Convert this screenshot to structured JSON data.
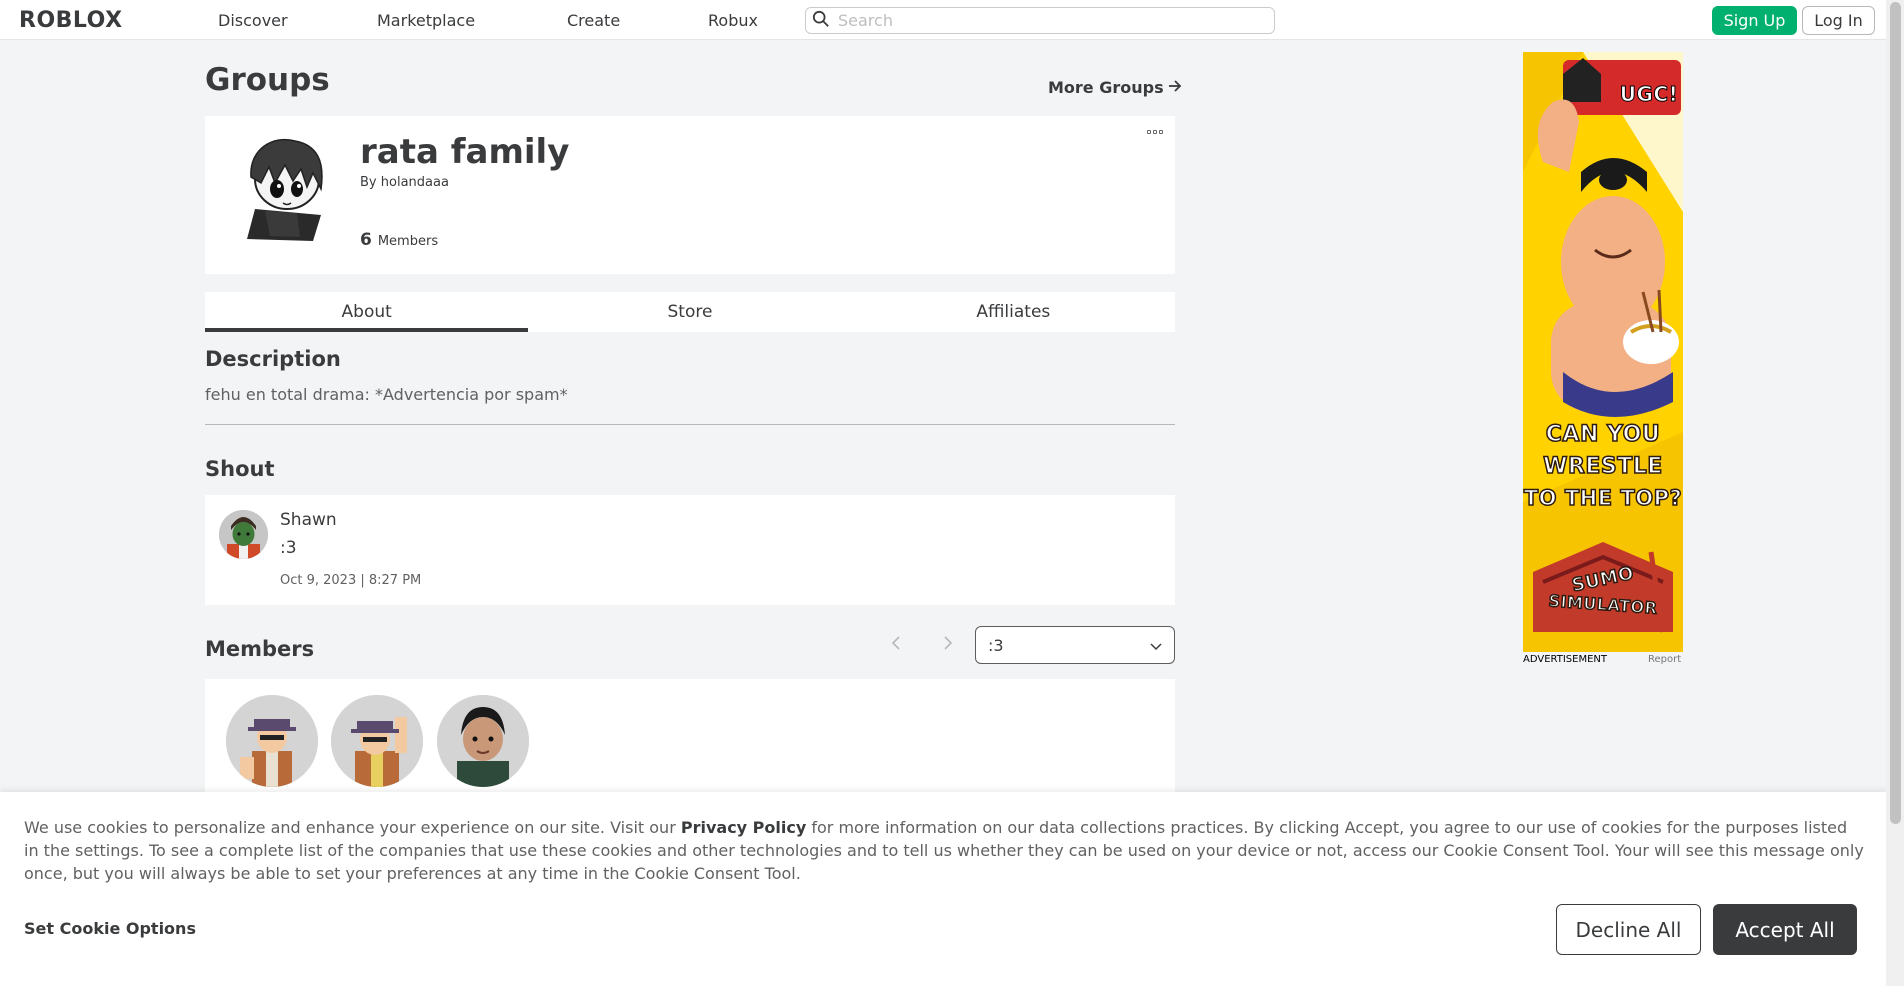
{
  "nav": {
    "logo": "ROBLOX",
    "links": [
      "Discover",
      "Marketplace",
      "Create",
      "Robux"
    ],
    "search_placeholder": "Search",
    "signup_label": "Sign Up",
    "login_label": "Log In"
  },
  "page": {
    "title": "Groups",
    "more_groups_label": "More Groups"
  },
  "group": {
    "name": "rata family",
    "by_label": "By",
    "owner": "holandaaa",
    "member_count": "6",
    "members_label": "Members"
  },
  "tabs": [
    {
      "label": "About",
      "active": true
    },
    {
      "label": "Store",
      "active": false
    },
    {
      "label": "Affiliates",
      "active": false
    }
  ],
  "description": {
    "title": "Description",
    "text": "fehu en total drama: *Advertencia por spam*"
  },
  "shout": {
    "title": "Shout",
    "author": "Shawn",
    "body": ":3",
    "date": "Oct 9, 2023 | 8:27 PM"
  },
  "members": {
    "title": "Members",
    "role_selected": ":3"
  },
  "ad": {
    "headline_1": "CAN YOU",
    "headline_2": "WRESTLE",
    "headline_3": "TO THE TOP?",
    "badge": "UGC!",
    "brand_1": "SUMO",
    "brand_2": "SIMULATOR",
    "label": "ADVERTISEMENT",
    "report": "Report"
  },
  "cookie": {
    "text_pre": "We use cookies to personalize and enhance your experience on our site. Visit our ",
    "privacy_link": "Privacy Policy",
    "text_post": " for more information on our data collections practices. By clicking Accept, you agree to our use of cookies for the purposes listed in the settings. To see a complete list of the companies that use these cookies and other technologies and to tell us whether they can be used on your device or not, access our Cookie Consent Tool. Your will see this message only once, but you will always be able to set your preferences at any time in the Cookie Consent Tool.",
    "options_label": "Set Cookie Options",
    "decline_label": "Decline All",
    "accept_label": "Accept All"
  }
}
